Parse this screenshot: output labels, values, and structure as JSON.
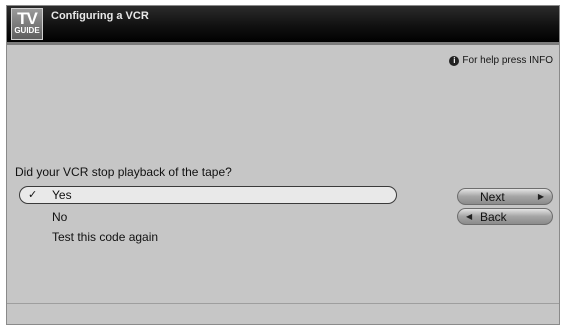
{
  "header": {
    "logo_top": "TV",
    "logo_bottom": "GUIDE",
    "title": "Configuring a VCR"
  },
  "help": {
    "icon": "info-icon",
    "text": "For help press INFO"
  },
  "question": "Did your VCR stop playback of the tape?",
  "options": [
    {
      "label": "Yes",
      "selected": true,
      "check": "✓"
    },
    {
      "label": "No",
      "selected": false
    },
    {
      "label": "Test this code again",
      "selected": false
    }
  ],
  "buttons": {
    "next_label": "Next",
    "back_label": "Back"
  }
}
